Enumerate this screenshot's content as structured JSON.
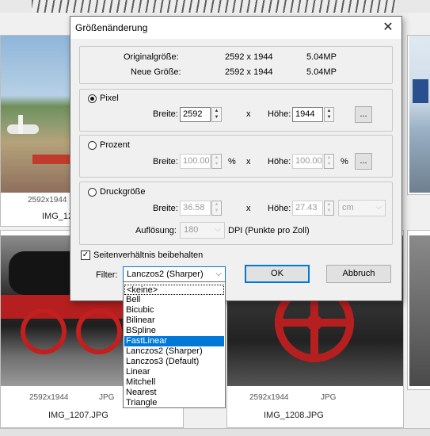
{
  "dialog": {
    "title": "Größenänderung",
    "original_label": "Originalgröße:",
    "original_dims": "2592 x 1944",
    "original_mp": "5.04MP",
    "new_label": "Neue Größe:",
    "new_dims": "2592 x 1944",
    "new_mp": "5.04MP",
    "pixel": {
      "label": "Pixel",
      "width_label": "Breite:",
      "width": "2592",
      "x": "x",
      "height_label": "Höhe:",
      "height": "1944",
      "more": "..."
    },
    "percent": {
      "label": "Prozent",
      "width_label": "Breite:",
      "width": "100.00",
      "unit": "%",
      "x": "x",
      "height_label": "Höhe:",
      "height": "100.00",
      "unit2": "%",
      "more": "..."
    },
    "print": {
      "label": "Druckgröße",
      "width_label": "Breite:",
      "width": "36.58",
      "x": "x",
      "height_label": "Höhe:",
      "height": "27.43",
      "unit": "cm",
      "res_label": "Auflösung:",
      "res": "180",
      "dpi": "DPI (Punkte pro Zoll)"
    },
    "aspect_label": "Seitenverhältnis beibehalten",
    "filter_label": "Filter:",
    "filter_value": "Lanczos2 (Sharper)",
    "ok": "OK",
    "cancel": "Abbruch"
  },
  "filter_options": [
    "<keine>",
    "Bell",
    "Bicubic",
    "Bilinear",
    "BSpline",
    "FastLinear",
    "Lanczos2 (Sharper)",
    "Lanczos3 (Default)",
    "Linear",
    "Mitchell",
    "Nearest",
    "Triangle"
  ],
  "filter_highlighted": "FastLinear",
  "thumbnails": [
    {
      "dims": "2592x1944",
      "name": "IMG_12"
    },
    {
      "dims": "2592x1944",
      "type": "JPG",
      "name": "IMG_1207.JPG"
    },
    {
      "dims": "2592x1944",
      "type": "JPG",
      "name": "IMG_1208.JPG"
    }
  ],
  "icons": {
    "close": "close-icon",
    "chevron": "chevron-down-icon",
    "spin_up": "spin-up-icon",
    "spin_down": "spin-down-icon"
  }
}
